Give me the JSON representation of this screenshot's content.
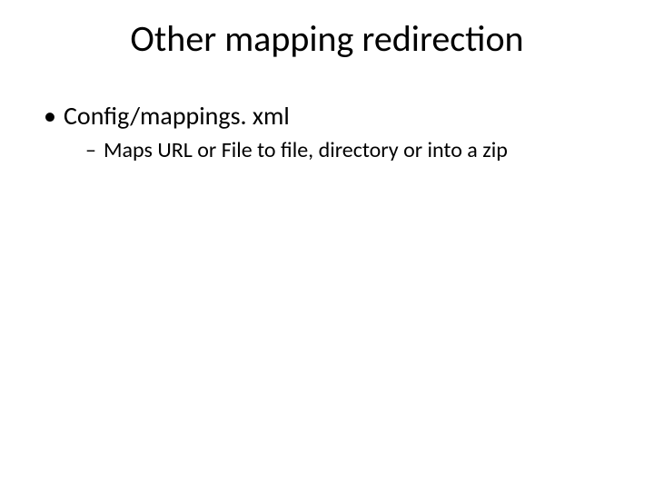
{
  "slide": {
    "title": "Other mapping redirection",
    "bullets": {
      "level1": {
        "marker": "•",
        "text": "Config/mappings. xml"
      },
      "level2": {
        "marker": "–",
        "text": "Maps URL or File to file, directory or into a zip"
      }
    }
  }
}
